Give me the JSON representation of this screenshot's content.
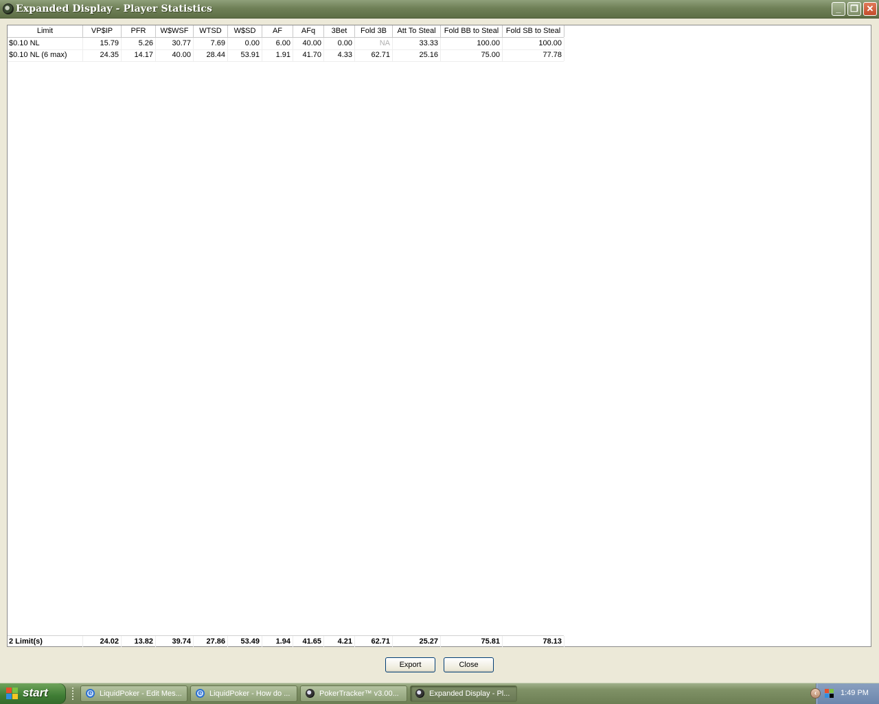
{
  "window": {
    "title": "Expanded Display - Player Statistics"
  },
  "table": {
    "columns": [
      "Limit",
      "VP$IP",
      "PFR",
      "W$WSF",
      "WTSD",
      "W$SD",
      "AF",
      "AFq",
      "3Bet",
      "Fold 3B",
      "Att To Steal",
      "Fold BB to Steal",
      "Fold SB to Steal"
    ],
    "rows": [
      [
        "$0.10 NL",
        "15.79",
        "5.26",
        "30.77",
        "7.69",
        "0.00",
        "6.00",
        "40.00",
        "0.00",
        "NA",
        "33.33",
        "100.00",
        "100.00"
      ],
      [
        "$0.10 NL (6 max)",
        "24.35",
        "14.17",
        "40.00",
        "28.44",
        "53.91",
        "1.91",
        "41.70",
        "4.33",
        "62.71",
        "25.16",
        "75.00",
        "77.78"
      ]
    ],
    "totals": [
      "2 Limit(s)",
      "24.02",
      "13.82",
      "39.74",
      "27.86",
      "53.49",
      "1.94",
      "41.65",
      "4.21",
      "62.71",
      "25.27",
      "75.81",
      "78.13"
    ]
  },
  "buttons": {
    "export": "Export",
    "close": "Close"
  },
  "taskbar": {
    "start": "start",
    "tasks": [
      {
        "label": "LiquidPoker - Edit Mes...",
        "icon": "ie-icon"
      },
      {
        "label": "LiquidPoker - How do ...",
        "icon": "ie-icon"
      },
      {
        "label": "PokerTracker™ v3.00...",
        "icon": "pokertracker-icon"
      },
      {
        "label": "Expanded Display - Pl...",
        "icon": "pokertracker-icon"
      }
    ],
    "clock": "1:49 PM"
  }
}
